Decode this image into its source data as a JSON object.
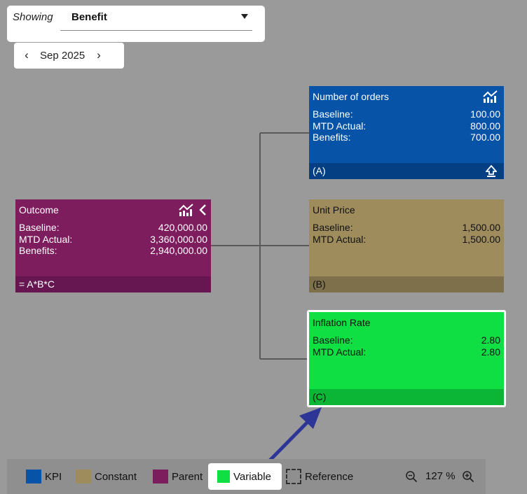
{
  "toolbar": {
    "showing_label": "Showing",
    "showing_value": "Benefit",
    "month": "Sep 2025"
  },
  "nodes": {
    "outcome": {
      "title": "Outcome",
      "rows": [
        {
          "label": "Baseline:",
          "value": "420,000.00"
        },
        {
          "label": "MTD Actual:",
          "value": "3,360,000.00"
        },
        {
          "label": "Benefits:",
          "value": "2,940,000.00"
        }
      ],
      "footer": "= A*B*C",
      "color": "#7e1d5e",
      "footer_color": "#661650",
      "icons": [
        "chart-icon",
        "chevron-left-icon"
      ]
    },
    "orders": {
      "title": "Number of orders",
      "rows": [
        {
          "label": "Baseline:",
          "value": "100.00"
        },
        {
          "label": "MTD Actual:",
          "value": "800.00"
        },
        {
          "label": "Benefits:",
          "value": "700.00"
        }
      ],
      "footer": "(A)",
      "color": "#0653a8",
      "footer_color": "#043f83",
      "icons": [
        "chart-icon",
        "upload-icon"
      ]
    },
    "unit_price": {
      "title": "Unit Price",
      "rows": [
        {
          "label": "Baseline:",
          "value": "1,500.00"
        },
        {
          "label": "MTD Actual:",
          "value": "1,500.00"
        }
      ],
      "footer": "(B)",
      "color": "#9e8c5d",
      "footer_color": "#7e704a"
    },
    "inflation": {
      "title": "Inflation Rate",
      "rows": [
        {
          "label": "Baseline:",
          "value": "2.80"
        },
        {
          "label": "MTD Actual:",
          "value": "2.80"
        }
      ],
      "footer": "(C)",
      "color": "#0fdf43",
      "footer_color": "#0bb536"
    }
  },
  "legend": {
    "items": [
      {
        "label": "KPI",
        "color": "#0653a8"
      },
      {
        "label": "Constant",
        "color": "#9e8c5d"
      },
      {
        "label": "Parent",
        "color": "#7e1d5e"
      },
      {
        "label": "Variable",
        "color": "#0fdf43"
      },
      {
        "label": "Reference",
        "color": "dashed"
      }
    ],
    "zoom": "127 %"
  },
  "annotation_color": "#2d3596"
}
